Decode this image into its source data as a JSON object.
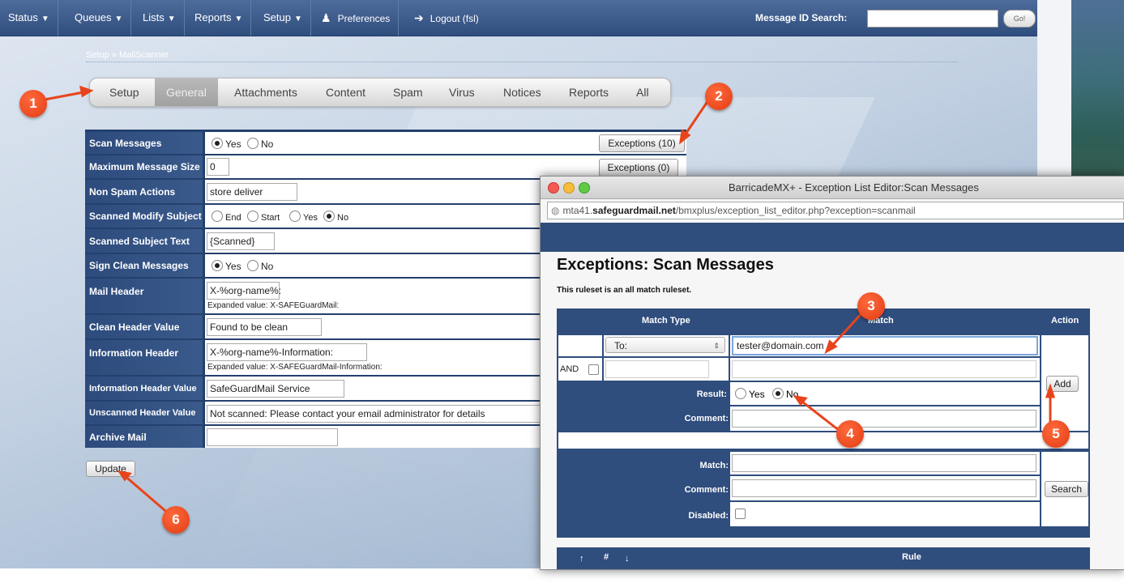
{
  "nav": {
    "status": "Status",
    "queues": "Queues",
    "lists": "Lists",
    "reports": "Reports",
    "setup": "Setup",
    "preferences": "Preferences",
    "logout": "Logout (fsl)",
    "msgid_label": "Message ID Search:",
    "go": "Go!"
  },
  "breadcrumb": "Setup » MailScanner",
  "tabs": [
    "Setup",
    "General",
    "Attachments",
    "Content",
    "Spam",
    "Virus",
    "Notices",
    "Reports",
    "All"
  ],
  "settings": {
    "scan_messages": {
      "label": "Scan Messages",
      "yes": "Yes",
      "no": "No",
      "exceptions": "Exceptions (10)"
    },
    "max_size": {
      "label": "Maximum Message Size",
      "value": "0",
      "exceptions": "Exceptions (0)"
    },
    "non_spam": {
      "label": "Non Spam Actions",
      "value": "store deliver"
    },
    "modify_subject": {
      "label": "Scanned Modify Subject",
      "opts": [
        "End",
        "Start",
        "Yes",
        "No"
      ]
    },
    "subject_text": {
      "label": "Scanned Subject Text",
      "value": "{Scanned}"
    },
    "sign_clean": {
      "label": "Sign Clean Messages",
      "yes": "Yes",
      "no": "No"
    },
    "mail_header": {
      "label": "Mail Header",
      "value": "X-%org-name%:",
      "expanded": "Expanded value:  X-SAFEGuardMail:"
    },
    "clean_header": {
      "label": "Clean Header Value",
      "value": "Found to be clean"
    },
    "info_header": {
      "label": "Information Header",
      "value": "X-%org-name%-Information:",
      "expanded": "Expanded value:  X-SAFEGuardMail-Information:"
    },
    "info_header_value": {
      "label": "Information Header Value",
      "value": "SafeGuardMail Service"
    },
    "unscanned_header": {
      "label": "Unscanned Header Value",
      "value": "Not scanned: Please contact your email administrator for details"
    },
    "archive_mail": {
      "label": "Archive Mail",
      "value": ""
    }
  },
  "update": "Update",
  "popup": {
    "title": "BarricadeMX+ - Exception List Editor:Scan Messages",
    "url_prefix": "mta41.",
    "url_domain": "safeguardmail.net",
    "url_path": "/bmxplus/exception_list_editor.php?exception=scanmail",
    "heading": "Exceptions: Scan Messages",
    "subtitle": "This ruleset is an all match ruleset.",
    "col_match_type": "Match Type",
    "col_match": "Match",
    "col_action": "Action",
    "match_type_value": "To:",
    "match_value": "tester@domain.com",
    "and": "AND",
    "result_label": "Result:",
    "result_yes": "Yes",
    "result_no": "No",
    "comment_label": "Comment:",
    "add": "Add",
    "search_match_label": "Match:",
    "search_comment_label": "Comment:",
    "disabled_label": "Disabled:",
    "search": "Search",
    "footer_up": "↑",
    "footer_hash": "#",
    "footer_down": "↓",
    "footer_rule": "Rule"
  },
  "annotations": [
    "1",
    "2",
    "3",
    "4",
    "5",
    "6"
  ],
  "colors": {
    "nav": "#2f4d7d",
    "badge": "#e8441c"
  }
}
